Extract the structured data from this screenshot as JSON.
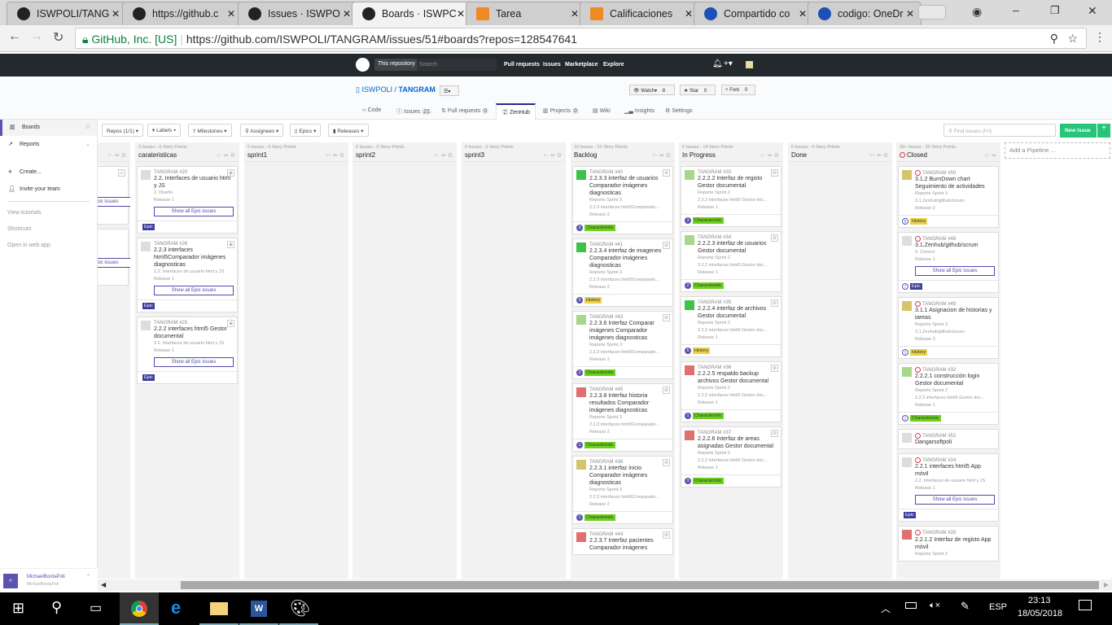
{
  "browser": {
    "tabs": [
      {
        "title": "ISWPOLI/TANG"
      },
      {
        "title": "https://github.c"
      },
      {
        "title": "Issues · ISWPO"
      },
      {
        "title": "Boards · ISWPC"
      },
      {
        "title": "Tarea"
      },
      {
        "title": "Calificaciones"
      },
      {
        "title": "Compartido co"
      },
      {
        "title": "codigo: OneDr"
      }
    ],
    "security": "GitHub, Inc. [US]",
    "url": "https://github.com/ISWPOLI/TANGRAM/issues/51#boards?repos=128547641"
  },
  "github": {
    "scope": "This repository",
    "search_placeholder": "Search",
    "nav": [
      "Pull requests",
      "Issues",
      "Marketplace",
      "Explore"
    ],
    "owner": "ISWPOLI",
    "repo": "TANGRAM",
    "watch": "Watch",
    "watch_count": "8",
    "star": "Star",
    "star_count": "0",
    "fork": "Fork",
    "fork_count": "0",
    "tabs": [
      {
        "label": "Code"
      },
      {
        "label": "Issues",
        "count": "21"
      },
      {
        "label": "Pull requests",
        "count": "0"
      },
      {
        "label": "ZenHub"
      },
      {
        "label": "Projects",
        "count": "0"
      },
      {
        "label": "Wiki"
      },
      {
        "label": "Insights"
      },
      {
        "label": "Settings"
      }
    ]
  },
  "sidebar": {
    "items": [
      "Boards",
      "Reports"
    ],
    "actions": [
      "Create...",
      "Invite your team"
    ],
    "links": [
      "View tutorials",
      "Shortcuts",
      "Open in web app"
    ],
    "user": "MichaelBordaPoli",
    "user_sub": "MichaelBordaPoli"
  },
  "toolbar": {
    "filters": [
      "Repos (1/1)",
      "Labels",
      "Milestones",
      "Assignees",
      "Epics",
      "Releases"
    ],
    "find_placeholder": "Find Issues (f+i)",
    "new_issue": "New Issue",
    "plus": "+"
  },
  "board": {
    "add_pipeline": "Add a Pipeline ...",
    "partial": {
      "button": "Show all Epic issues"
    },
    "columns": [
      {
        "meta": "3 Issues - 0 Story Points",
        "title": "carateristicas",
        "cards": [
          {
            "num": "TANGRAM #20",
            "title": "2.2. Interfaces de usuario html y JS",
            "meta": [
              "2. Diseño",
              "Release 1"
            ],
            "button": "Show all Epic issues",
            "label": "Epic",
            "avatar": "#ddd"
          },
          {
            "num": "TANGRAM #26",
            "title": "2.2.3 interfaces html5Comparador imágenes diagnosticas",
            "meta": [
              "2.2. Interfaces de usuario html y JS",
              "Release 1"
            ],
            "button": "Show all Epic issues",
            "label": "Epic",
            "avatar": "#ddd"
          },
          {
            "num": "TANGRAM #25",
            "title": "2.2.2 interfaces html5 Gestor documental",
            "meta": [
              "2.2. Interfaces de usuario html y JS",
              "Release 1"
            ],
            "button": "Show all Epic issues",
            "label": "Epic",
            "avatar": "#ddd"
          }
        ]
      },
      {
        "meta": "0 Issues - 0 Story Points",
        "title": "sprint1",
        "cards": []
      },
      {
        "meta": "0 Issues - 0 Story Points",
        "title": "sprint2",
        "cards": []
      },
      {
        "meta": "0 Issues - 0 Story Points",
        "title": "sprint3",
        "cards": []
      },
      {
        "meta": "10 Issues - 22 Story Points",
        "title": "Backlog",
        "cards": [
          {
            "num": "TANGRAM #40",
            "title": "2.2.3.3 interfaz de usuarios Comparador imágenes diagnosticas",
            "meta": [
              "Reporte Sprint 3",
              "2.2.3 interfaces html5Comparado...",
              "Release 2"
            ],
            "estimate": "3",
            "label": "Characteristic",
            "avatar": "#3fc24a"
          },
          {
            "num": "TANGRAM #41",
            "title": "2.2.3.4 interfaz de imagenes Comparador imágenes diagnosticas",
            "meta": [
              "Reporte Sprint 3",
              "2.2.3 interfaces html5Comparado...",
              "Release 2"
            ],
            "estimate": "5",
            "label": "History",
            "avatar": "#3fc24a"
          },
          {
            "num": "TANGRAM #43",
            "title": "2.2.3.6 Interfaz Comparar imágenes Comparador imágenes diagnosticas",
            "meta": [
              "Reporte Sprint 3",
              "2.2.3 interfaces html5Comparado...",
              "Release 2"
            ],
            "estimate": "3",
            "label": "Characteristic",
            "avatar": "#a8d68a"
          },
          {
            "num": "TANGRAM #45",
            "title": "2.2.3.8 Interfaz historia resultados Comparador imágenes diagnosticas",
            "meta": [
              "Reporte Sprint 3",
              "2.2.3 interfaces html5Comparado...",
              "Release 2"
            ],
            "estimate": "1",
            "label": "Characteristic",
            "avatar": "#e07070"
          },
          {
            "num": "TANGRAM #38",
            "title": "2.2.3.1 interfaz inicio Comparador imágenes diagnosticas",
            "meta": [
              "Reporte Sprint 3",
              "2.2.3 interfaces html5Comparado...",
              "Release 2"
            ],
            "estimate": "1",
            "label": "Characteristic",
            "avatar": "#d6c46a"
          },
          {
            "num": "TANGRAM #44",
            "title": "2.2.3.7 Interfaz pacientes Comparador imágenes",
            "meta": [],
            "avatar": "#e07070"
          }
        ]
      },
      {
        "meta": "5 Issues - 14 Story Points",
        "title": "In Progress",
        "cards": [
          {
            "num": "TANGRAM #33",
            "title": "2.2.2.2 Interfaz de registo Gestor documental",
            "meta": [
              "Reporte Sprint 2",
              "2.2.2 interfaces html5 Gestor doc...",
              "Release 1"
            ],
            "estimate": "3",
            "label": "Characteristic",
            "avatar": "#a8d68a"
          },
          {
            "num": "TANGRAM #34",
            "title": "2.2.2.3 interfaz de usuarios Gestor documental",
            "meta": [
              "Reporte Sprint 2",
              "2.2.2 interfaces html5 Gestor doc...",
              "Release 1"
            ],
            "estimate": "2",
            "label": "Characteristic",
            "avatar": "#a8d68a"
          },
          {
            "num": "TANGRAM #35",
            "title": "2.2.2.4 interfaz de archivos Gestor documental",
            "meta": [
              "Reporte Sprint 2",
              "2.2.2 interfaces html5 Gestor doc...",
              "Release 1"
            ],
            "estimate": "5",
            "label": "History",
            "avatar": "#3fc24a"
          },
          {
            "num": "TANGRAM #36",
            "title": "2.2.2.5 respaldo backup archivos Gestor documental",
            "meta": [
              "Reporte Sprint 2",
              "2.2.2 interfaces html5 Gestor doc...",
              "Release 1"
            ],
            "estimate": "1",
            "label": "Characteristic",
            "avatar": "#e07070"
          },
          {
            "num": "TANGRAM #37",
            "title": "2.2.2.6 Interfaz de areas asignadas Gestor documental",
            "meta": [
              "Reporte Sprint 2",
              "2.2.2 interfaces html5 Gestor doc...",
              "Release 1"
            ],
            "estimate": "3",
            "label": "Characteristic",
            "avatar": "#e07070"
          }
        ]
      },
      {
        "meta": "0 Issues - 0 Story Points",
        "title": "Done",
        "cards": []
      },
      {
        "meta": "32+ Issues - 35 Story Points",
        "title": "Closed",
        "closed": true,
        "cards": [
          {
            "num": "TANGRAM #50",
            "title": "3.1.2 BurnDown chart Seguimiento de actividades",
            "meta": [
              "Reporte Sprint 3",
              "3.1.Zenhub/github/scrum",
              "Release 2"
            ],
            "estimate": "5",
            "label": "History",
            "avatar": "#d6c46a"
          },
          {
            "num": "TANGRAM #48",
            "title": "3.1.Zenhub/github/scrum",
            "meta": [
              "3. Control",
              "Release 1"
            ],
            "button": "Show all Epic issues",
            "estimate": "7",
            "label": "Epic",
            "avatar": "#ddd"
          },
          {
            "num": "TANGRAM #49",
            "title": "3.1.1 Asignacion de historias y tareas",
            "meta": [
              "Reporte Sprint 3",
              "3.1.Zenhub/github/scrum",
              "Release 2"
            ],
            "estimate": "1",
            "label": "History",
            "avatar": "#d6c46a"
          },
          {
            "num": "TANGRAM #32",
            "title": "2.2.2.1 construcción login Gestor documental",
            "meta": [
              "Reporte Sprint 2",
              "2.2.2 interfaces html5 Gestor doc...",
              "Release 1"
            ],
            "estimate": "1",
            "label": "Characteristic",
            "avatar": "#a8d68a"
          },
          {
            "num": "TANGRAM #52",
            "title": "Dangarsoftpoli",
            "meta": [],
            "avatar": "#ddd"
          },
          {
            "num": "TANGRAM #24",
            "title": "2.2.1 interfaces html5 App móvil",
            "meta": [
              "2.2. Interfaces de usuario html y JS",
              "Release 1"
            ],
            "button": "Show all Epic issues",
            "label": "Epic",
            "avatar": "#ddd"
          },
          {
            "num": "TANGRAM #28",
            "title": "2.2.1.2 Interfaz de registo App móvil",
            "meta": [
              "Reporte Sprint 2"
            ],
            "avatar": "#e07070"
          }
        ]
      }
    ]
  },
  "label_colors": {
    "Characteristic": "#6cd11b",
    "History": "#e8d34a",
    "Epic": "#3e3ea0"
  },
  "taskbar": {
    "lang": "ESP",
    "time": "23:13",
    "date": "18/05/2018"
  }
}
